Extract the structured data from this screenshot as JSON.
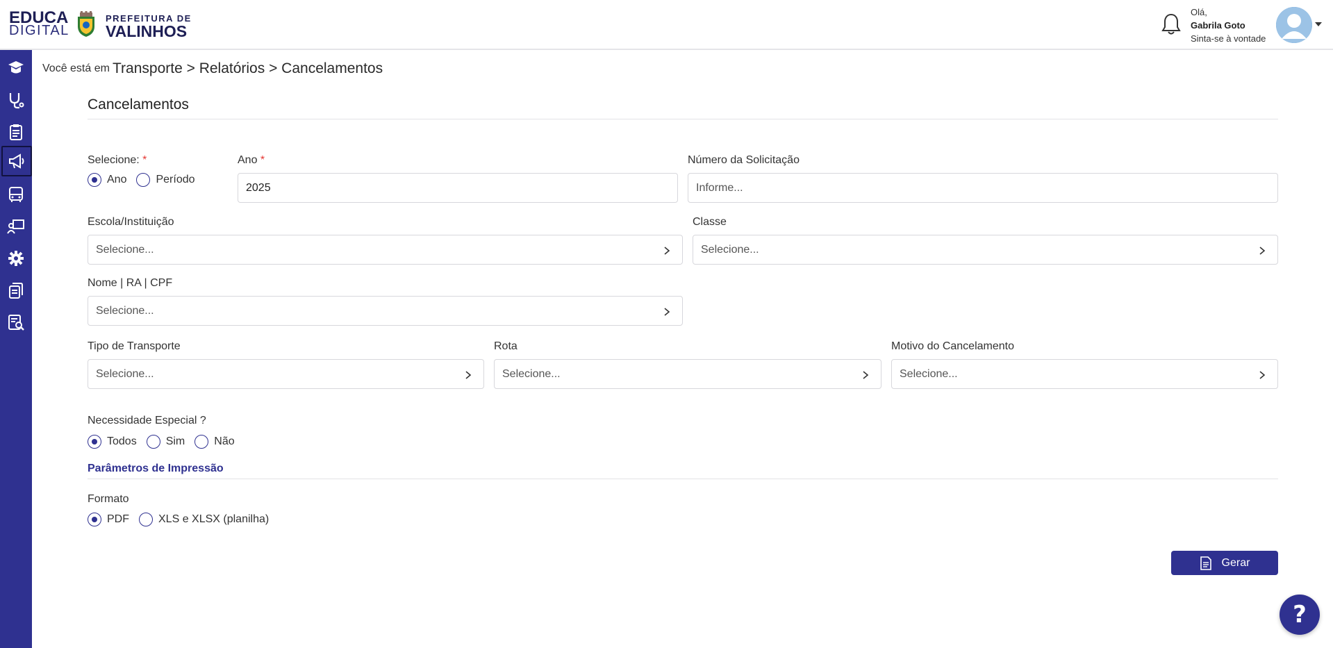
{
  "header": {
    "logo_line1": "EDUCA",
    "logo_line2": "DIGITAL",
    "pref_line1": "PREFEITURA DE",
    "pref_line2": "VALINHOS",
    "greeting": "Olá,",
    "user_name": "Gabrila Goto",
    "user_sub": "Sinta-se à vontade"
  },
  "sidebar": {
    "items": [
      {
        "icon": "graduation-icon"
      },
      {
        "icon": "stethoscope-icon"
      },
      {
        "icon": "clipboard-icon"
      },
      {
        "icon": "megaphone-icon",
        "active": true
      },
      {
        "icon": "bus-icon"
      },
      {
        "icon": "teacher-board-icon"
      },
      {
        "icon": "gear-icon"
      },
      {
        "icon": "documents-icon"
      },
      {
        "icon": "report-search-icon"
      }
    ]
  },
  "breadcrumb": {
    "prefix": "Você está em",
    "path": "Transporte > Relatórios > Cancelamentos"
  },
  "page": {
    "title": "Cancelamentos"
  },
  "form": {
    "selecione_label": "Selecione:",
    "required_mark": "*",
    "selecione_options": [
      "Ano",
      "Período"
    ],
    "selecione_selected": "Ano",
    "ano_label": "Ano",
    "ano_value": "2025",
    "numero_label": "Número da Solicitação",
    "numero_placeholder": "Informe...",
    "escola_label": "Escola/Instituição",
    "classe_label": "Classe",
    "nome_label": "Nome | RA | CPF",
    "tipo_label": "Tipo de Transporte",
    "rota_label": "Rota",
    "motivo_label": "Motivo do Cancelamento",
    "select_placeholder": "Selecione...",
    "necessidade_label": "Necessidade Especial ?",
    "necessidade_options": [
      "Todos",
      "Sim",
      "Não"
    ],
    "necessidade_selected": "Todos"
  },
  "print": {
    "section_title": "Parâmetros de Impressão",
    "formato_label": "Formato",
    "formato_options": [
      "PDF",
      "XLS e XLSX (planilha)"
    ],
    "formato_selected": "PDF"
  },
  "actions": {
    "gerar_label": "Gerar"
  },
  "help": {
    "label": "?"
  },
  "colors": {
    "primary": "#2f3190",
    "required": "#e53935"
  }
}
